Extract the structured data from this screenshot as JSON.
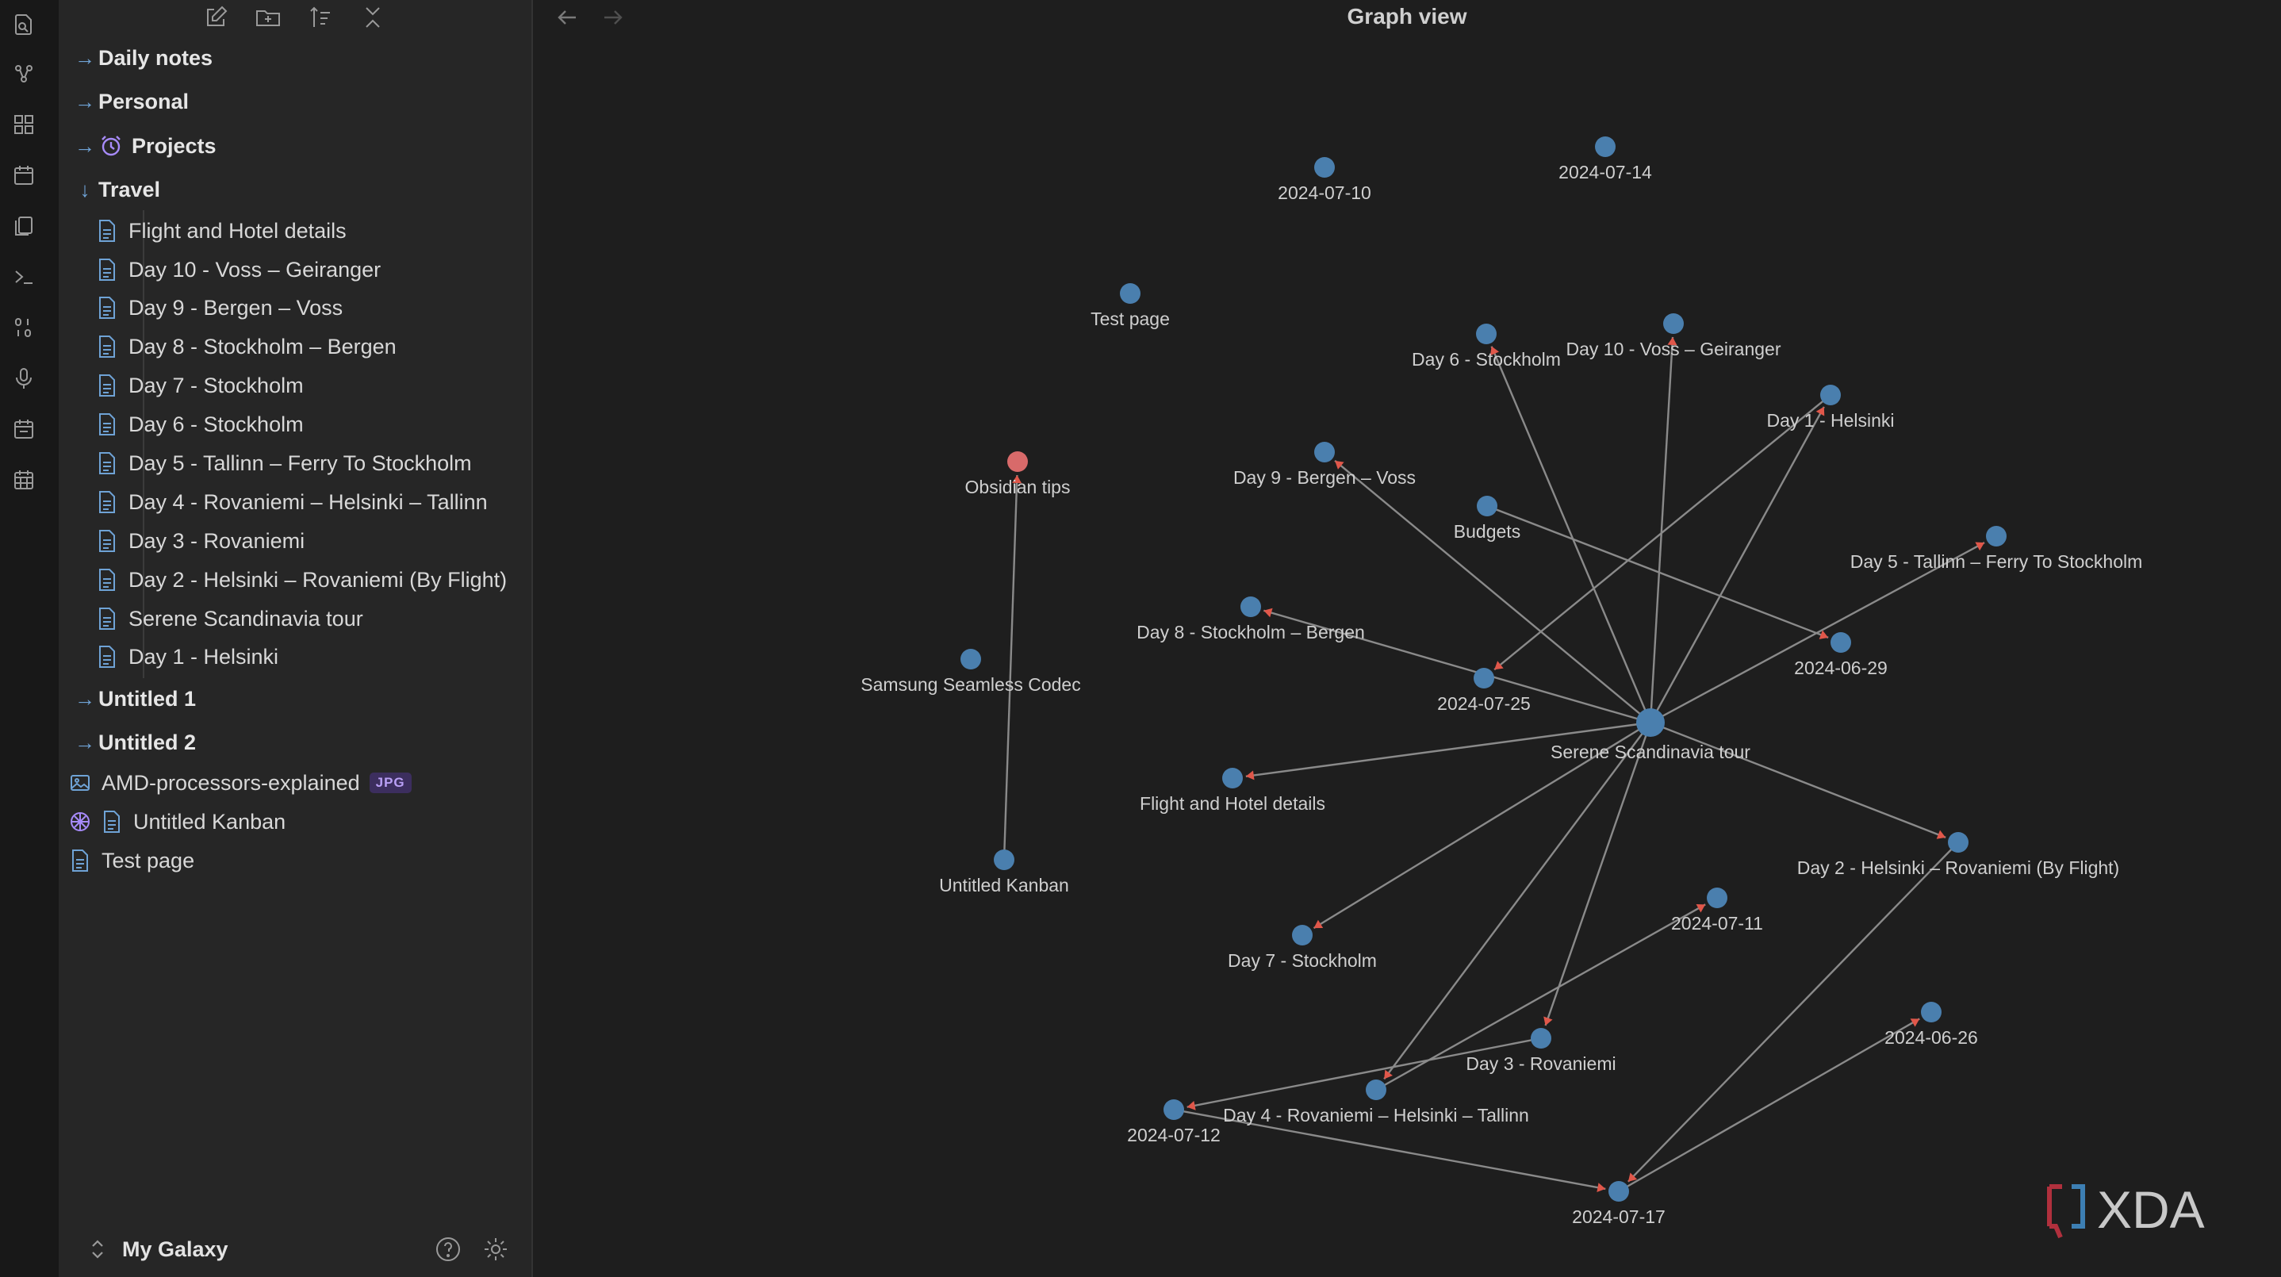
{
  "ribbon": {
    "icons": [
      "search-icon",
      "graph-icon",
      "grid-icon",
      "calendar-icon",
      "files-icon",
      "terminal-icon",
      "binary-icon",
      "microphone-icon",
      "calendar-check-icon",
      "calendar-grid-icon"
    ]
  },
  "sidebar": {
    "toolbar_icons": [
      "new-note-icon",
      "new-folder-icon",
      "sort-icon",
      "collapse-icon"
    ],
    "folders": [
      {
        "label": "Daily notes",
        "expanded": false
      },
      {
        "label": "Personal",
        "expanded": false
      },
      {
        "label": "Projects",
        "expanded": false,
        "icon": "alarm-clock-icon"
      },
      {
        "label": "Travel",
        "expanded": true
      }
    ],
    "travel_files": [
      "Flight and Hotel details",
      "Day 10 - Voss – Geiranger",
      "Day 9 - Bergen – Voss",
      "Day 8 - Stockholm – Bergen",
      "Day 7 - Stockholm",
      "Day 6 - Stockholm",
      "Day 5 - Tallinn – Ferry To Stockholm",
      "Day 4 - Rovaniemi – Helsinki – Tallinn",
      "Day 3 - Rovaniemi",
      "Day 2 - Helsinki – Rovaniemi (By Flight)",
      "Serene Scandinavia tour",
      "Day 1 - Helsinki"
    ],
    "more_folders": [
      {
        "label": "Untitled 1"
      },
      {
        "label": "Untitled 2"
      }
    ],
    "root_files": [
      {
        "label": "AMD-processors-explained",
        "badge": "JPG",
        "icon": "image-icon"
      },
      {
        "label": "Untitled Kanban",
        "icon": "kanban-icon"
      },
      {
        "label": "Test page",
        "icon": "file-icon"
      }
    ],
    "vault_name": "My Galaxy"
  },
  "graph": {
    "title": "Graph view",
    "colors": {
      "node": "#4a7fae",
      "orphan_tip": "#d86a6a",
      "edge": "#8a8a8a",
      "arrow": "#e0574a",
      "background": "#1e1e1e"
    },
    "nodes": [
      {
        "id": "n0710",
        "label": "2024-07-10"
      },
      {
        "id": "n0714",
        "label": "2024-07-14"
      },
      {
        "id": "testpage",
        "label": "Test page"
      },
      {
        "id": "day6",
        "label": "Day 6 - Stockholm"
      },
      {
        "id": "day10",
        "label": "Day 10 - Voss – Geiranger"
      },
      {
        "id": "day1",
        "label": "Day 1 - Helsinki"
      },
      {
        "id": "obsidian",
        "label": "Obsidian tips"
      },
      {
        "id": "day9",
        "label": "Day 9 - Bergen – Voss"
      },
      {
        "id": "budgets",
        "label": "Budgets"
      },
      {
        "id": "day5",
        "label": "Day 5 - Tallinn – Ferry To Stockholm"
      },
      {
        "id": "day8",
        "label": "Day 8 - Stockholm – Bergen"
      },
      {
        "id": "n0629",
        "label": "2024-06-29"
      },
      {
        "id": "samsung",
        "label": "Samsung Seamless Codec"
      },
      {
        "id": "n0725",
        "label": "2024-07-25"
      },
      {
        "id": "serene",
        "label": "Serene Scandinavia tour"
      },
      {
        "id": "flight",
        "label": "Flight and Hotel details"
      },
      {
        "id": "day2",
        "label": "Day 2 - Helsinki – Rovaniemi (By Flight)"
      },
      {
        "id": "kanban",
        "label": "Untitled Kanban"
      },
      {
        "id": "n0711",
        "label": "2024-07-11"
      },
      {
        "id": "day7",
        "label": "Day 7 - Stockholm"
      },
      {
        "id": "n0626",
        "label": "2024-06-26"
      },
      {
        "id": "day3",
        "label": "Day 3 - Rovaniemi"
      },
      {
        "id": "day4",
        "label": "Day 4 - Rovaniemi – Helsinki – Tallinn"
      },
      {
        "id": "n0712",
        "label": "2024-07-12"
      },
      {
        "id": "n0717",
        "label": "2024-07-17"
      }
    ],
    "edges": [
      [
        "serene",
        "day6"
      ],
      [
        "serene",
        "day10"
      ],
      [
        "serene",
        "day1"
      ],
      [
        "serene",
        "day9"
      ],
      [
        "serene",
        "day5"
      ],
      [
        "serene",
        "day8"
      ],
      [
        "serene",
        "flight"
      ],
      [
        "serene",
        "day2"
      ],
      [
        "serene",
        "day7"
      ],
      [
        "serene",
        "day3"
      ],
      [
        "serene",
        "day4"
      ],
      [
        "budgets",
        "n0629"
      ],
      [
        "day1",
        "n0725"
      ],
      [
        "kanban",
        "obsidian"
      ],
      [
        "day4",
        "n0711"
      ],
      [
        "day3",
        "n0712"
      ],
      [
        "n0712",
        "n0717"
      ],
      [
        "n0717",
        "n0626"
      ],
      [
        "day2",
        "n0717"
      ]
    ]
  },
  "watermark": "XDA"
}
